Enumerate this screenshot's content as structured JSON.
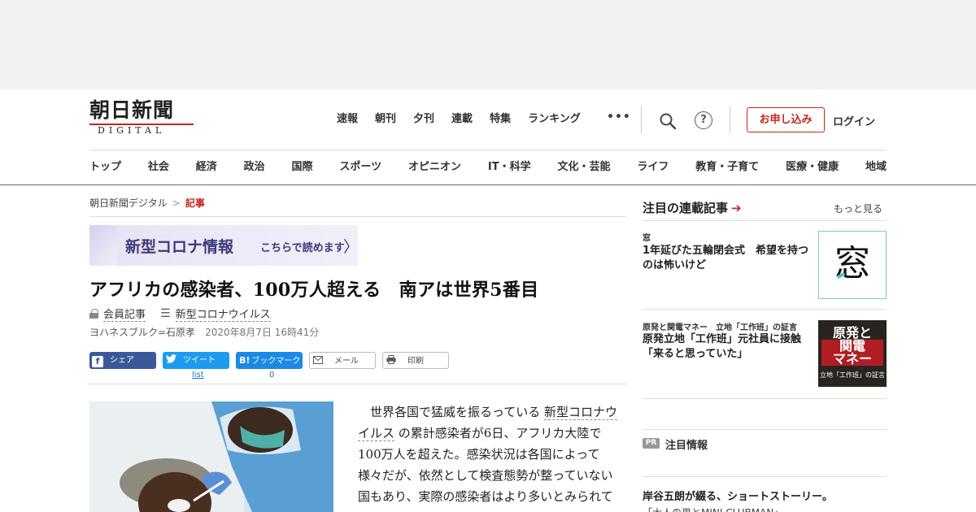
{
  "logo": {
    "kanji": "朝日新聞",
    "sub": "DIGITAL"
  },
  "top_nav": [
    "速報",
    "朝刊",
    "夕刊",
    "連載",
    "特集",
    "ランキング"
  ],
  "more_label": "•••",
  "help_label": "?",
  "subscribe_label": "お申し込み",
  "login_label": "ログイン",
  "categories": [
    "トップ",
    "社会",
    "経済",
    "政治",
    "国際",
    "スポーツ",
    "オピニオン",
    "IT・科学",
    "文化・芸能",
    "ライフ",
    "教育・子育て",
    "医療・健康",
    "地域"
  ],
  "breadcrumb": {
    "home": "朝日新聞デジタル",
    "sep": ">",
    "current": "記事"
  },
  "banner": {
    "title": "新型コロナ情報",
    "sub": "こちらで読めます",
    "arrow": "〉"
  },
  "article": {
    "headline": "アフリカの感染者、100万人超える　南アは世界5番目",
    "member_label": "会員記事",
    "topic_label": "新型コロナウイルス",
    "byline": "ヨハネスブルク=石原孝",
    "date": "2020年8月7日 16時41分",
    "body_pre": "世界各国で猛威を振るっている",
    "body_link": "新型コロナウイルス",
    "body_post": "の累計感染者が6日、アフリカ大陸で100万人を超えた。感染状況は各国によって様々だが、依然として検査態勢が整っていない国もあり、実際の感染者はより多いとみられている。"
  },
  "share": {
    "facebook": {
      "icon": "f",
      "label": "シェア"
    },
    "twitter": {
      "label": "ツイート",
      "count": "list"
    },
    "hatena": {
      "icon": "B!",
      "label": "ブックマーク",
      "count": "0"
    },
    "mail": {
      "label": "メール"
    },
    "print": {
      "label": "印刷"
    }
  },
  "sidebar": {
    "heading": "注目の連載記事",
    "heading_arrow": "➔",
    "more": "もっと見る",
    "items": [
      {
        "kicker": "窓",
        "title": "1年延びた五輪閉会式　希望を持つのは怖いけど",
        "thumb": "窓"
      },
      {
        "kicker": "原発と関電マネー　立地「工作班」の証言",
        "title": "原発立地「工作班」元社員に接触　「来ると思っていた」",
        "thumb_line1": "原発と",
        "thumb_line2": "関電\nマネー",
        "thumb_line3": "立地「工作班」の証言"
      }
    ],
    "pr_badge": "PR",
    "pr_heading": "注目情報",
    "promo_title": "岸谷五朗が綴る、ショートストーリー。",
    "promo_sub": "「大人の男とMINI CLUBMAN」"
  },
  "colors": {
    "brand_red": "#c0281c",
    "facebook": "#3b5998",
    "twitter": "#1d9bf0",
    "hatena": "#1a8ae5",
    "banner_text": "#3c3a7a"
  }
}
